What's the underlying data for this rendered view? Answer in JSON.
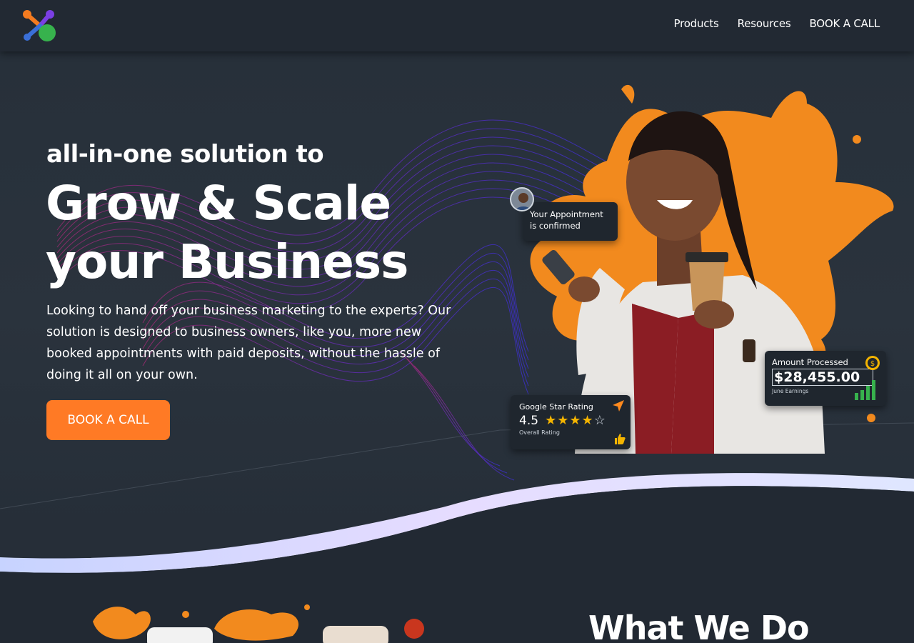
{
  "header": {
    "logo_icon": "brand-logo-icon",
    "nav": [
      {
        "label": "Products"
      },
      {
        "label": "Resources"
      },
      {
        "label": "BOOK A CALL"
      }
    ]
  },
  "hero": {
    "kicker": "all-in-one solution to",
    "headline_line1": "Grow & Scale",
    "headline_line2": "your Business",
    "description": "Looking to hand off your business marketing to the experts? Our solution is designed to business owners, like you, more new booked appointments with paid deposits, without the hassle of doing it all on your own.",
    "cta_label": "BOOK A CALL"
  },
  "cards": {
    "appointment": {
      "line1": "Your Appointment",
      "line2": "is confirmed"
    },
    "rating": {
      "title": "Google Star Rating",
      "value": "4.5",
      "stars_filled": "★★★★",
      "stars_empty": "☆",
      "caption": "Overall Rating"
    },
    "amount": {
      "title": "Amount Processed",
      "value": "$28,455.00",
      "caption": "June Earnings"
    }
  },
  "section": {
    "title": "What We Do"
  },
  "colors": {
    "background": "#222933",
    "accent": "#ff7a25",
    "splash": "#f28a1e"
  }
}
